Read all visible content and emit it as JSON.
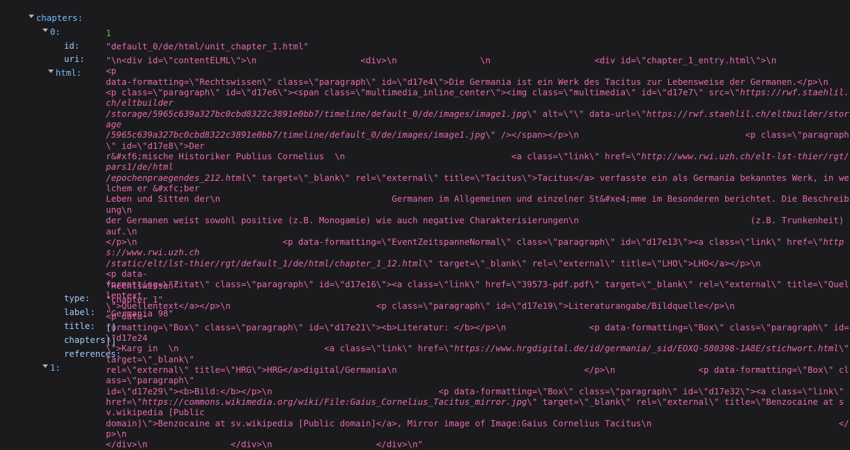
{
  "theme": {
    "background": "#1b1b1d",
    "key_color": "#9ecbff",
    "string_color": "#e868b0",
    "number_color": "#6cc644",
    "twisty_color": "#b1b1b3"
  },
  "inspector": {
    "root": {
      "key": "chapters:",
      "expanded": true
    },
    "index_node": {
      "key": "0:",
      "expanded": true
    },
    "properties": [
      {
        "key": "id:",
        "value": "1",
        "kind": "number",
        "expandable": false
      },
      {
        "key": "uri:",
        "value": "\"default_0/de/html/unit_chapter_1.html\"",
        "kind": "string",
        "expandable": false
      },
      {
        "key": "html:",
        "value": "",
        "kind": "string",
        "expandable": true
      },
      {
        "key": "type:",
        "value": "\"Rechtswissen\"",
        "kind": "string",
        "expandable": false
      },
      {
        "key": "label:",
        "value": "\"chapter_1\"",
        "kind": "string",
        "expandable": false
      },
      {
        "key": "title:",
        "value": "\"Germania 98\"",
        "kind": "string",
        "expandable": false
      },
      {
        "key": "chapters:",
        "value": "[]",
        "kind": "array",
        "expandable": false
      },
      {
        "key": "references:",
        "value": "[]",
        "kind": "array",
        "expandable": false
      }
    ],
    "next_node": {
      "key": "1:",
      "expanded": true
    },
    "html_value_segments": [
      {
        "text": "\"\\n<div id=\\\"contentELML\\\">\\n                    <div>\\n                \\n                    <div id=\\\"chapter_1_entry.html\\\">\\n                            <p\ndata-formatting=\\\"Rechtswissen\\\" class=\\\"paragraph\\\" id=\\\"d17e4\\\">Die Germania ist ein Werk des Tacitus zur Lebensweise der Germanen.</p>\\n\n<p class=\\\"paragraph\\\" id=\\\"d17e6\\\"><span class=\\\"multimedia_inline_center\\\"><img class=\\\"multimedia\\\" id=\\\"d17e7\\\" src=\\\"",
        "italic": false
      },
      {
        "text": "https://rwf.staehlil.ch/eltbuilder\n/storage/5965c639a327bc0cbd8322c3891e0bb7/timeline/default_0/de/images/image1.jpg",
        "italic": true
      },
      {
        "text": "\\\" alt=\\\"\\\" data-url=\\\"",
        "italic": false
      },
      {
        "text": "https://rwf.staehlil.ch/eltbuilder/storage\n/5965c639a327bc0cbd8322c3891e0bb7/timeline/default_0/de/images/image1.jpg",
        "italic": true
      },
      {
        "text": "\\\" /></span></p>\\n                                <p class=\\\"paragraph\\\" id=\\\"d17e8\\\">Der\nr&#xf6;mische Historiker Publius Cornelius  \\n                                <a class=\\\"link\\\" href=\\\"",
        "italic": false
      },
      {
        "text": "http://www.rwi.uzh.ch/elt-lst-thier/rgt/pars1/de/html\n/epochenpraegendes_212.html",
        "italic": true
      },
      {
        "text": "\\\" target=\\\"_blank\\\" rel=\\\"external\\\" title=\\\"Tacitus\\\">Tacitus</a> verfasste ein als Germania bekanntes Werk, in welchem er &#xfc;ber\nLeben und Sitten der\\n                                 Germanen im Allgemeinen und einzelner St&#xe4;mme im Besonderen berichtet. Die Beschreibung\\n\nder Germanen weist sowohl positive (z.B. Monogamie) wie auch negative Charakterisierungen\\n                                 (z.B. Trunkenheit) auf.\\n\n</p>\\n                            <p data-formatting=\\\"EventZeitspanneNormal\\\" class=\\\"paragraph\\\" id=\\\"d17e13\\\"><a class=\\\"link\\\" href=\\\"",
        "italic": false
      },
      {
        "text": "https://www.rwi.uzh.ch\n/static/elt/lst-thier/rgt/default_1/de/html/chapter_1_12.html",
        "italic": true
      },
      {
        "text": "\\\" target=\\\"_blank\\\" rel=\\\"external\\\" title=\\\"LHO\\\">LHO</a></p>\\n                                   <p data-\nformatting=\\\"Zitat\\\" class=\\\"paragraph\\\" id=\\\"d17e16\\\"><a class=\\\"link\\\" href=\\\"39573-pdf.pdf\\\" target=\\\"_blank\\\" rel=\\\"external\\\" title=\\\"Quellentext\n\\\">Quellentext</a></p>\\n                            <p class=\\\"paragraph\\\" id=\\\"d17e19\\\">Literaturangabe/Bildquelle</p>\\n                            <p data-\nformatting=\\\"Box\\\" class=\\\"paragraph\\\" id=\\\"d17e21\\\"><b>Literatur: </b></p>\\n                <p data-formatting=\\\"Box\\\" class=\\\"paragraph\\\" id=\\\"d17e24\n\\\">Karg in  \\n                            <a class=\\\"link\\\" href=\\\"",
        "italic": false
      },
      {
        "text": "https://www.hrgdigital.de/id/germania/_sid/EOXQ-580398-1A8E/stichwort.html",
        "italic": true
      },
      {
        "text": "\\\" target=\\\"_blank\\\"\nrel=\\\"external\\\" title=\\\"HRG\\\">HRG</a>digital/Germania\\n                                    </p>\\n                <p data-formatting=\\\"Box\\\" class=\\\"paragraph\\\"\nid=\\\"d17e29\\\"><b>Bild:</b></p>\\n                                <p data-formatting=\\\"Box\\\" class=\\\"paragraph\\\" id=\\\"d17e32\\\"><a class=\\\"link\\\"\nhref=\\\"",
        "italic": false
      },
      {
        "text": "https://commons.wikimedia.org/wiki/File:Gaius_Cornelius_Tacitus_mirror.jpg",
        "italic": true
      },
      {
        "text": "\\\" target=\\\"_blank\\\" rel=\\\"external\\\" title=\\\"Benzocaine at sv.wikipedia [Public\ndomain]\\\">Benzocaine at sv.wikipedia [Public domain]</a>, Mirror image of Image:Gaius Cornelius Tacitus\\n                                    </p>\\n\n</div>\\n                </div>\\n                    </div>\\n\"",
        "italic": false
      }
    ]
  }
}
